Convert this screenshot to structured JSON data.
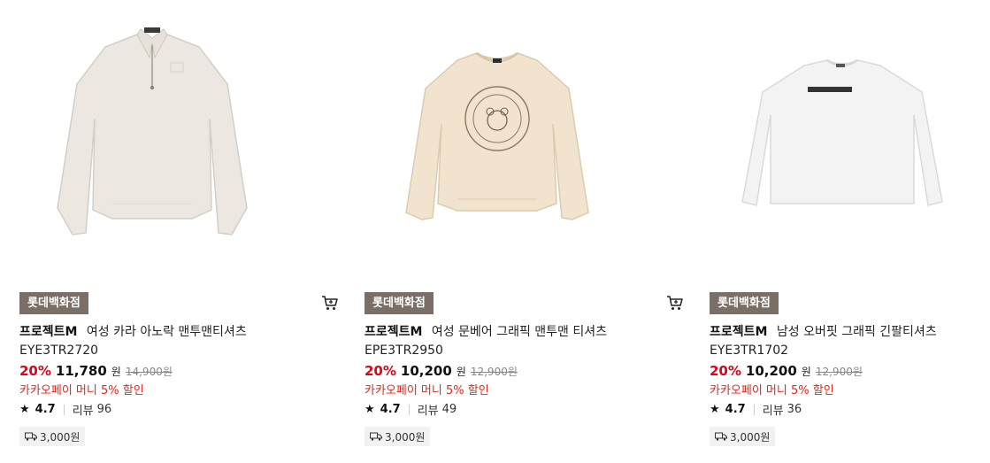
{
  "products": [
    {
      "store_badge": "롯데백화점",
      "brand": "프로젝트M",
      "name": "여성 카라 아노락 맨투맨티셔츠",
      "code": "EYE3TR2720",
      "discount": "20%",
      "sale_price": "11,780",
      "currency": "원",
      "original_price": "14,900원",
      "promo": "카카오페이 머니 5% 할인",
      "rating": "4.7",
      "review_label": "리뷰",
      "review_count": "96",
      "shipping_fee": "3,000원",
      "icons": {
        "cart": "cart-icon",
        "star": "star-icon",
        "truck": "truck-icon"
      },
      "image": {
        "garment": "half-zip collar sweatshirt",
        "color": "#ece8e1",
        "tag": "PRJCT M"
      }
    },
    {
      "store_badge": "롯데백화점",
      "brand": "프로젝트M",
      "name": "여성 문베어 그래픽 맨투맨 티셔츠",
      "code": "EPE3TR2950",
      "discount": "20%",
      "sale_price": "10,200",
      "currency": "원",
      "original_price": "12,900원",
      "promo": "카카오페이 머니 5% 할인",
      "rating": "4.7",
      "review_label": "리뷰",
      "review_count": "49",
      "shipping_fee": "3,000원",
      "icons": {
        "cart": "cart-icon",
        "star": "star-icon",
        "truck": "truck-icon"
      },
      "image": {
        "garment": "crewneck sweatshirt with circular bear graphic",
        "color": "#f1e3cd"
      }
    },
    {
      "store_badge": "롯데백화점",
      "brand": "프로젝트M",
      "name": "남성 오버핏 그래픽 긴팔티셔츠",
      "code": "EYE3TR1702",
      "discount": "20%",
      "sale_price": "10,200",
      "currency": "원",
      "original_price": "12,900원",
      "promo": "카카오페이 머니 5% 할인",
      "rating": "4.7",
      "review_label": "리뷰",
      "review_count": "36",
      "shipping_fee": "3,000원",
      "icons": {
        "cart": null,
        "star": "star-icon",
        "truck": "truck-icon"
      },
      "image": {
        "garment": "long sleeve tee",
        "color": "#f3f3f3",
        "print": "Essential Studio°"
      }
    }
  ],
  "colors": {
    "badge_bg": "#7a6f67",
    "discount": "#e60012",
    "promo": "#e0281b",
    "shipping_bg": "#f2f2f2"
  }
}
